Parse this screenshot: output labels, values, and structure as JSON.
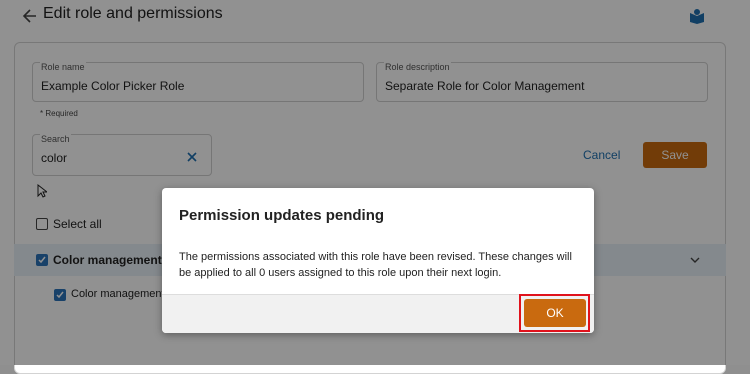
{
  "header": {
    "title": "Edit role and permissions",
    "back_icon": "arrow-left-icon",
    "help_icon": "book-icon",
    "accent": "#1e6fb0"
  },
  "form": {
    "role_name": {
      "label": "Role name",
      "value": "Example Color Picker Role"
    },
    "role_description": {
      "label": "Role description",
      "value": "Separate Role for Color Management"
    },
    "required_note": "* Required",
    "search": {
      "label": "Search",
      "value": "color"
    },
    "cancel_label": "Cancel",
    "save_label": "Save"
  },
  "permissions": {
    "select_all_label": "Select all",
    "group_label": "Color management",
    "child_label": "Color management"
  },
  "dialog": {
    "title": "Permission updates pending",
    "body": "The permissions associated with this role have been revised. These changes will be applied to all 0 users assigned to this role upon their next login.",
    "ok_label": "OK"
  },
  "colors": {
    "primary_button": "#c96a0f",
    "checkbox_checked": "#2b73b9",
    "highlight_frame": "#e0121c"
  }
}
